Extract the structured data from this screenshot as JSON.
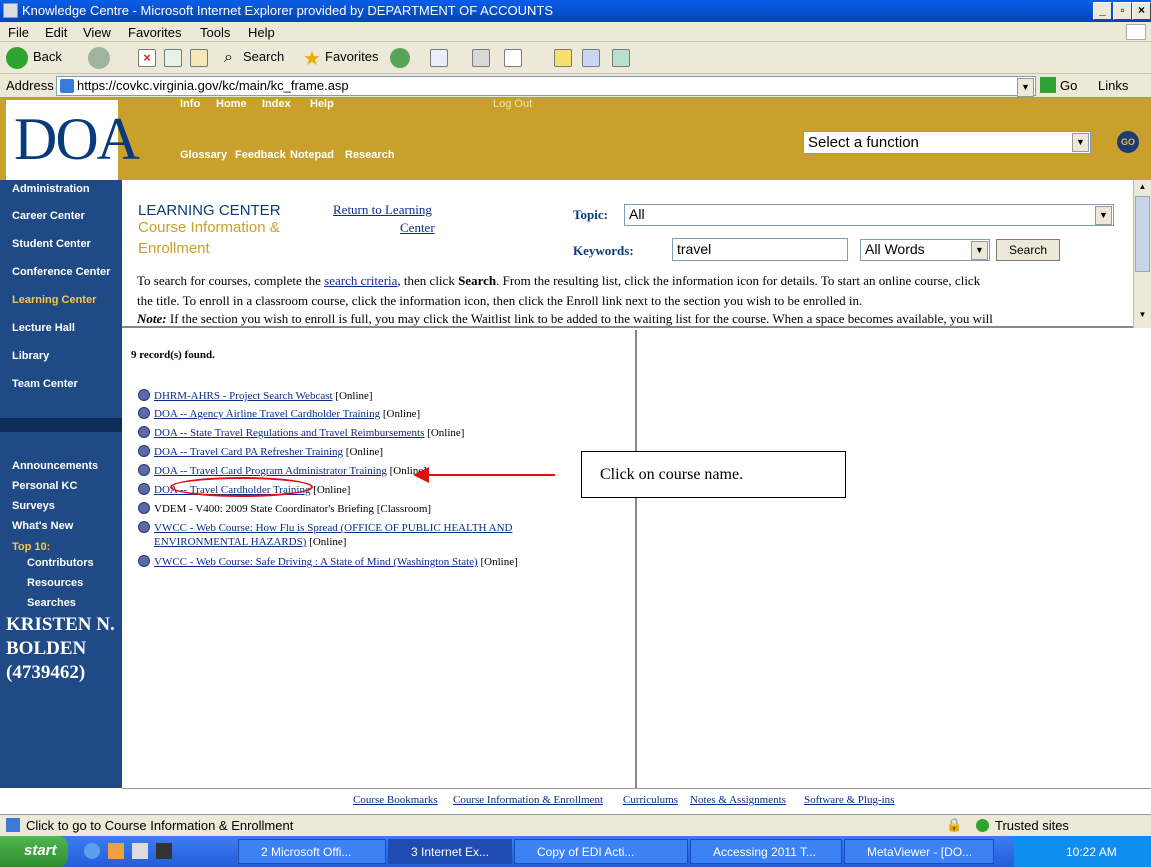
{
  "window": {
    "title": "Knowledge Centre - Microsoft Internet Explorer provided by DEPARTMENT OF ACCOUNTS"
  },
  "menu": [
    "File",
    "Edit",
    "View",
    "Favorites",
    "Tools",
    "Help"
  ],
  "toolbar": {
    "back": "Back",
    "search": "Search",
    "favorites": "Favorites"
  },
  "address": {
    "label": "Address",
    "url": "https://covkc.virginia.gov/kc/main/kc_frame.asp",
    "go": "Go",
    "links": "Links"
  },
  "site": {
    "logo": "DOA",
    "nav_top": [
      "Info",
      "Home",
      "Index",
      "Help"
    ],
    "logout": "Log Out",
    "nav_bottom": [
      "Glossary",
      "Feedback",
      "Notepad",
      "Research"
    ],
    "function_select": "Select a function",
    "go_badge": "GO"
  },
  "sidebar": {
    "items": [
      "Administration",
      "Career Center",
      "Student Center",
      "Conference Center",
      "Learning Center",
      "Lecture Hall",
      "Library",
      "Team Center"
    ],
    "secondary": [
      "Announcements",
      "Personal KC",
      "Surveys",
      "What's New"
    ],
    "top10": "Top 10:",
    "top10_items": [
      "Contributors",
      "Resources",
      "Searches"
    ],
    "user_lines": [
      "KRISTEN N.",
      "BOLDEN",
      "(4739462)"
    ]
  },
  "learning": {
    "title": "LEARNING CENTER",
    "subtitle1": "Course Information &",
    "subtitle2": "Enrollment",
    "return1": "Return to Learning",
    "return2": "Center",
    "topic_label": "Topic:",
    "topic_value": "All",
    "keywords_label": "Keywords:",
    "keywords_value": "travel",
    "match_value": "All Words",
    "search_button": "Search",
    "para1a": "To search for courses, complete the ",
    "para1_link": "search criteria",
    "para1b": ", then click ",
    "para1_bold": "Search",
    "para1c": ". From the resulting list, click the information icon for details. To start an online course, click",
    "para2": "the title. To enroll in a classroom course, click the information icon, then click the Enroll link next to the section you wish to be enrolled in.",
    "note_label": "Note:",
    "para3": " If the section you wish to enroll is full, you may click the Waitlist link to be added to the waiting list for the course. When a space becomes available, you will"
  },
  "results": {
    "count": "9 record(s) found.",
    "courses": [
      {
        "name": "DHRM-AHRS - Project Search Webcast",
        "type": "[Online]"
      },
      {
        "name": "DOA -- Agency Airline Travel Cardholder Training",
        "type": "[Online]"
      },
      {
        "name": "DOA -- State Travel Regulations and Travel Reimbursements",
        "type": "[Online]"
      },
      {
        "name": "DOA -- Travel Card PA Refresher Training",
        "type": "[Online]"
      },
      {
        "name": "DOA -- Travel Card Program Administrator Training",
        "type": "[Online]"
      },
      {
        "name": "DOA -- Travel Cardholder Training",
        "type": "[Online]"
      },
      {
        "name": "VDEM - V400: 2009 State Coordinator's Briefing",
        "type": "[Classroom]"
      },
      {
        "name": "VWCC - Web Course: How Flu is Spread (OFFICE OF PUBLIC HEALTH AND",
        "name2": "ENVIRONMENTAL HAZARDS)",
        "type": "[Online]"
      },
      {
        "name": "VWCC - Web Course: Safe Driving : A State of Mind (Washington State)",
        "type": "[Online]"
      }
    ]
  },
  "callout": "Click on course name.",
  "footer_links": [
    "Course Bookmarks",
    "Course Information & Enrollment",
    "Curriculums",
    "Notes & Assignments",
    "Software & Plug-ins"
  ],
  "status": {
    "text": "Click to go to Course Information & Enrollment",
    "zone": "Trusted sites"
  },
  "taskbar": {
    "start": "start",
    "buttons": [
      "2 Microsoft Offi...",
      "3 Internet Ex...",
      "Copy of EDI Acti...",
      "Accessing 2011 T...",
      "MetaViewer - [DO..."
    ],
    "time": "10:22 AM"
  }
}
